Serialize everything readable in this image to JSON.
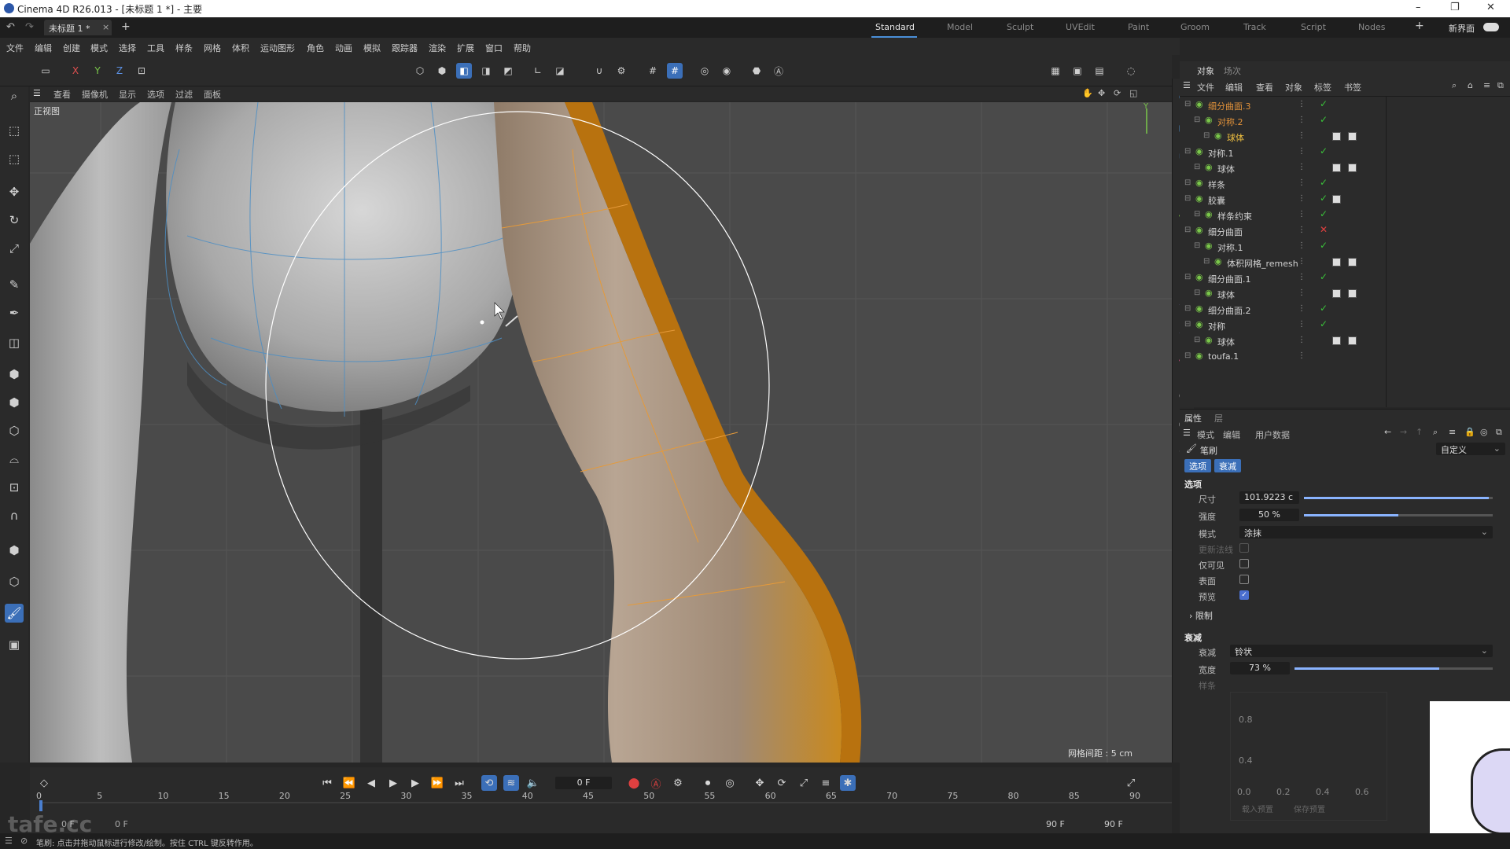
{
  "window": {
    "title": "Cinema 4D R26.013 - [未标题 1 *] - 主要",
    "controls": [
      "–",
      "❐",
      "✕"
    ]
  },
  "tabs": {
    "document": "未标题 1 *",
    "close": "×",
    "add": "+",
    "workspaces": [
      "Standard",
      "Model",
      "Sculpt",
      "UVEdit",
      "Paint",
      "Groom",
      "Track",
      "Script",
      "Nodes"
    ],
    "active_workspace": "Standard",
    "new_interface": "新界面"
  },
  "menu": [
    "文件",
    "编辑",
    "创建",
    "模式",
    "选择",
    "工具",
    "样条",
    "网格",
    "体积",
    "运动图形",
    "角色",
    "动画",
    "模拟",
    "跟踪器",
    "渲染",
    "扩展",
    "窗口",
    "帮助"
  ],
  "axes": [
    "X",
    "Y",
    "Z"
  ],
  "viewport": {
    "menu": [
      "查看",
      "摄像机",
      "显示",
      "选项",
      "过滤",
      "面板"
    ],
    "name": "正视图",
    "grid_spacing": "网格间距 : 5 cm",
    "axis_label": "Y"
  },
  "timeline": {
    "current_frame": "0 F",
    "ticks": [
      "0",
      "5",
      "10",
      "15",
      "20",
      "25",
      "30",
      "35",
      "40",
      "45",
      "50",
      "55",
      "60",
      "65",
      "70",
      "75",
      "80",
      "85",
      "90"
    ],
    "start_left": "0 F",
    "start_right": "0 F",
    "end_left": "90 F",
    "end_right": "90 F"
  },
  "object_manager": {
    "tabs": [
      "对象",
      "场次"
    ],
    "menu": [
      "文件",
      "编辑",
      "查看",
      "对象",
      "标签",
      "书签"
    ],
    "objects": [
      {
        "name": "细分曲面.3",
        "indent": 0,
        "style": "orange",
        "status": "ok",
        "tags": 0
      },
      {
        "name": "对称.2",
        "indent": 1,
        "style": "orange",
        "status": "ok",
        "tags": 0
      },
      {
        "name": "球体",
        "indent": 2,
        "style": "hl",
        "status": "",
        "tags": 2
      },
      {
        "name": "对称.1",
        "indent": 0,
        "style": "",
        "status": "ok",
        "tags": 0
      },
      {
        "name": "球体",
        "indent": 1,
        "style": "",
        "status": "",
        "tags": 2
      },
      {
        "name": "样条",
        "indent": 0,
        "style": "",
        "status": "ok",
        "tags": 0
      },
      {
        "name": "胶囊",
        "indent": 0,
        "style": "",
        "status": "ok",
        "tags": 1
      },
      {
        "name": "样条约束",
        "indent": 1,
        "style": "",
        "status": "ok",
        "tags": 0
      },
      {
        "name": "细分曲面",
        "indent": 0,
        "style": "",
        "status": "x",
        "tags": 0
      },
      {
        "name": "对称.1",
        "indent": 1,
        "style": "",
        "status": "ok",
        "tags": 0
      },
      {
        "name": "体积网格_remesh",
        "indent": 2,
        "style": "",
        "status": "",
        "tags": 2
      },
      {
        "name": "细分曲面.1",
        "indent": 0,
        "style": "",
        "status": "ok",
        "tags": 0
      },
      {
        "name": "球体",
        "indent": 1,
        "style": "",
        "status": "",
        "tags": 2
      },
      {
        "name": "细分曲面.2",
        "indent": 0,
        "style": "",
        "status": "ok",
        "tags": 0
      },
      {
        "name": "对称",
        "indent": 0,
        "style": "",
        "status": "ok",
        "tags": 0
      },
      {
        "name": "球体",
        "indent": 1,
        "style": "",
        "status": "",
        "tags": 2
      },
      {
        "name": "toufa.1",
        "indent": 0,
        "style": "",
        "status": "",
        "tags": 0
      }
    ]
  },
  "attributes": {
    "tabs": [
      "属性",
      "层"
    ],
    "menu": [
      "模式",
      "编辑",
      "用户数据"
    ],
    "tool_name": "笔刷",
    "preset": "自定义",
    "subtabs": [
      "选项",
      "衰减"
    ],
    "section_options": "选项",
    "size_label": "尺寸",
    "size_value": "101.9223 c",
    "size_fraction": 0.98,
    "strength_label": "强度",
    "strength_value": "50 %",
    "strength_fraction": 0.5,
    "mode_label": "模式",
    "mode_value": "涂抹",
    "update_normals": "更新法线",
    "visible_only": "仅可见",
    "surface": "表面",
    "preview": "预览",
    "limit": "限制",
    "section_falloff": "衰减",
    "falloff_label": "衰减",
    "falloff_value": "铃状",
    "width_label": "宽度",
    "width_value": "73 %",
    "width_fraction": 0.73,
    "spline_label": "样条",
    "curve_y": [
      "0.8",
      "0.4"
    ],
    "curve_x": [
      "0.0",
      "0.2",
      "0.4",
      "0.6"
    ],
    "curve_buttons": [
      "载入预置",
      "保存预置"
    ]
  },
  "status": {
    "message": "笔刷: 点击并拖动鼠标进行修改/绘制。按住 CTRL 键反转作用。",
    "watermark": "tafe.cc"
  },
  "colors": {
    "accent": "#3b6fb8",
    "selection": "#e08a1e",
    "viewport_bg": "#4a4a4a",
    "panel_bg": "#2b2b2b"
  }
}
